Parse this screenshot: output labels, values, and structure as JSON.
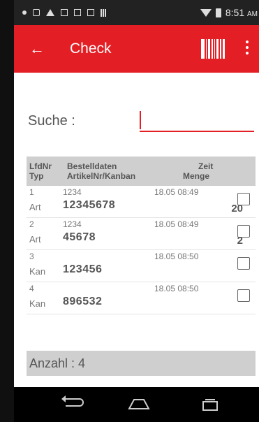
{
  "status_bar": {
    "time": "8:51",
    "time_suffix": "AM",
    "icons": [
      "signal-icon",
      "bag-icon",
      "warning-icon",
      "image-icon",
      "square-icon",
      "square-icon",
      "sd-card-icon"
    ]
  },
  "app_bar": {
    "title": "Check",
    "back_icon": "arrow-back-icon",
    "barcode_icon": "barcode-icon",
    "menu_icon": "overflow-menu-icon",
    "color": "#e31e24"
  },
  "search": {
    "label": "Suche :",
    "value": ""
  },
  "table": {
    "headers": {
      "lfdnr": "LfdNr",
      "typ": "Typ",
      "bestelldaten": "Bestelldaten",
      "artikel": "ArtikelNr/Kanban",
      "zeit": "Zeit",
      "menge": "Menge"
    },
    "rows": [
      {
        "lfdnr": "1",
        "typ": "Art",
        "bestell": "1234",
        "artikel": "12345678",
        "zeit": "18.05 08:49",
        "menge": "20",
        "checked": false
      },
      {
        "lfdnr": "2",
        "typ": "Art",
        "bestell": "1234",
        "artikel": "45678",
        "zeit": "18.05 08:49",
        "menge": "2",
        "checked": false
      },
      {
        "lfdnr": "3",
        "typ": "Kan",
        "bestell": "",
        "artikel": "123456",
        "zeit": "18.05 08:50",
        "menge": "",
        "checked": false
      },
      {
        "lfdnr": "4",
        "typ": "Kan",
        "bestell": "",
        "artikel": "896532",
        "zeit": "18.05 08:50",
        "menge": "",
        "checked": false
      }
    ]
  },
  "footer": {
    "count_label": "Anzahl : 4"
  },
  "nav": {
    "back": "nav-back-icon",
    "home": "nav-home-icon",
    "recent": "nav-recent-icon"
  }
}
